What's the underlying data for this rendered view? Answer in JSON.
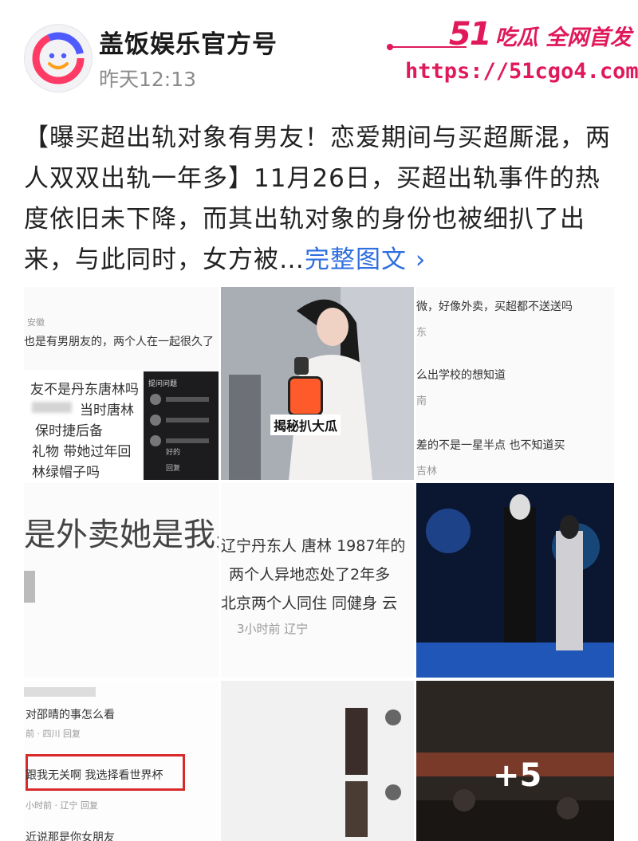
{
  "header": {
    "account_name": "盖饭娱乐官方号",
    "post_time": "昨天12:13"
  },
  "watermark": {
    "logo_number": "51",
    "logo_text": "吃瓜 全网首发",
    "url": "https://51cgo4.com",
    "color": "#e0195a"
  },
  "post": {
    "text": "【曝买超出轨对象有男友！恋爱期间与买超厮混，两人双双出轨一年多】11月26日，买超出轨事件的热度依旧未下降，而其出轨对象的身份也被细扒了出来，与此同时，女方被…",
    "more_link": "完整图文 ›"
  },
  "tiles": {
    "t1": {
      "small_label": "安徽",
      "line1": "也是有男朋友的，两个人在一起很久了",
      "card_lines": [
        "友不是丹东唐林吗",
        "当时唐林",
        "保时捷后备",
        "礼物 带她过年回",
        "林绿帽子吗"
      ],
      "dark_card_lines": [
        "提问问题",
        "好的",
        "回复"
      ]
    },
    "t2": {
      "sticker": "揭秘扒大瓜"
    },
    "t3": {
      "lines": [
        "微，好像外卖，买超都不送送吗",
        "东",
        "么出学校的想知道",
        "南",
        "差的不是一星半点 也不知道买",
        "吉林"
      ]
    },
    "t4": {
      "big_text": "是外卖她是我男"
    },
    "t5": {
      "lines": [
        "辽宁丹东人 唐林 1987年的",
        "两个人异地恋处了2年多",
        "北京两个人同住 同健身 云"
      ],
      "meta": "3小时前 辽宁"
    },
    "t7": {
      "line1": "对邵晴的事怎么看",
      "meta": "前 · 四川  回复",
      "boxed": "跟我无关啊 我选择看世界杯",
      "meta2": "小时前 · 辽宁  回复",
      "line_bottom": "近说那是你女朋友"
    },
    "t9": {
      "more_count": "+5"
    }
  }
}
